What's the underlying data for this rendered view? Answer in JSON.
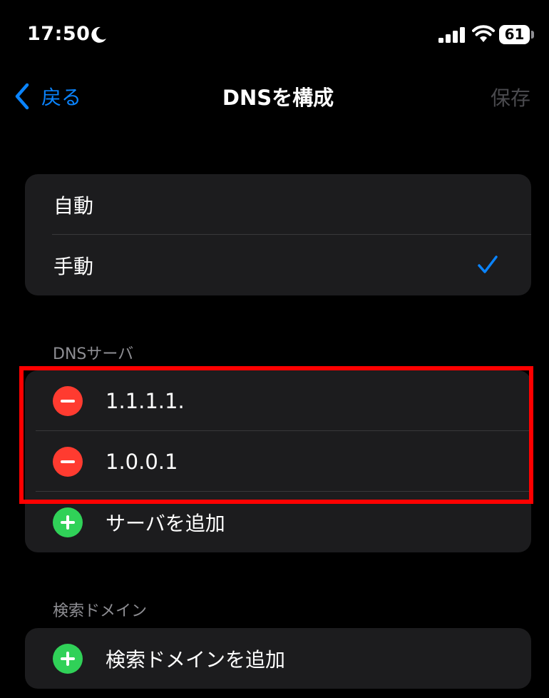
{
  "status_bar": {
    "time": "17:50",
    "battery": "61"
  },
  "nav": {
    "back_label": "戻る",
    "title": "DNSを構成",
    "save_label": "保存"
  },
  "mode_group": {
    "items": [
      {
        "label": "自動",
        "selected": false
      },
      {
        "label": "手動",
        "selected": true
      }
    ]
  },
  "dns_section": {
    "header": "DNSサーバ",
    "servers": [
      "1.1.1.1.",
      "1.0.0.1"
    ],
    "add_label": "サーバを追加"
  },
  "search_section": {
    "header": "検索ドメイン",
    "add_label": "検索ドメインを追加"
  },
  "colors": {
    "accent": "#0a84ff",
    "delete": "#ff3b30",
    "add": "#30d158",
    "highlight": "#ff0000"
  }
}
